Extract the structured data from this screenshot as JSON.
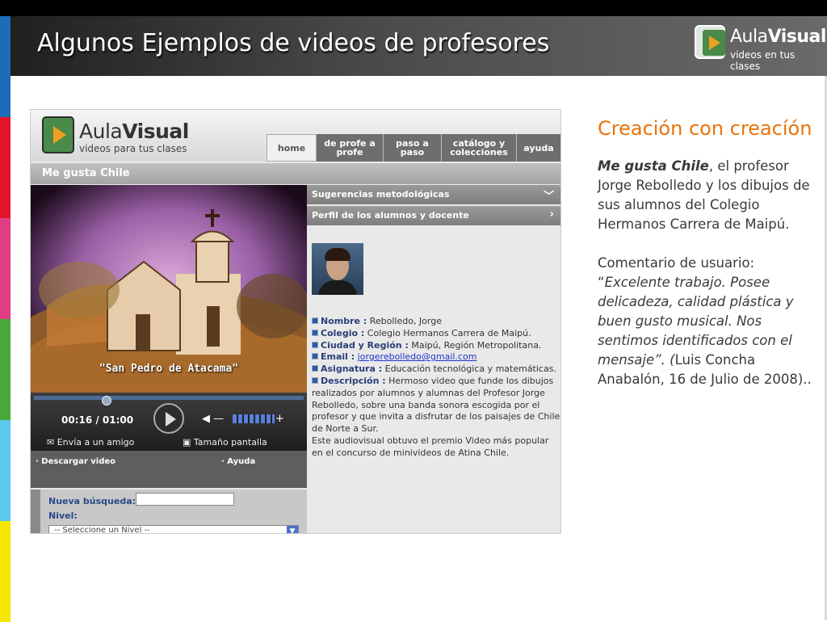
{
  "slide": {
    "title": "Algunos Ejemplos de videos de profesores",
    "logo": {
      "aula": "Aula",
      "visual": "Visual",
      "subtitle": "videos en tus clases"
    },
    "stripe_colors": [
      "#1e6bb8",
      "#e4142a",
      "#e03d86",
      "#4aa83a",
      "#5bc8ec",
      "#f6e600"
    ]
  },
  "screenshot": {
    "logo": {
      "aula": "Aula",
      "visual": "Visual",
      "subtitle": "videos para tus clases"
    },
    "nav": [
      {
        "label": "home"
      },
      {
        "label": "de profe a profe"
      },
      {
        "label": "paso a paso"
      },
      {
        "label": "catálogo y colecciones"
      },
      {
        "label": "ayuda"
      }
    ],
    "page_title": "Me gusta Chile",
    "video": {
      "caption": "\"San Pedro de Atacama\"",
      "time": "00:16 / 01:00",
      "progress": 0.27,
      "share_label": "Envía a un amigo",
      "fullscreen_label": "Tamaño pantalla"
    },
    "links": {
      "download": "· Descargar video",
      "help": "· Ayuda"
    },
    "search": {
      "new_search_label": "Nueva búsqueda:",
      "level_label": "Nivel:",
      "level_select": "-- Seleccione un Nivel --"
    },
    "accordion": [
      {
        "label": "Sugerencias metodológicas",
        "chevron": "﹀"
      },
      {
        "label": "Perfil de los alumnos y docente",
        "chevron": "›"
      }
    ],
    "profile": {
      "nombre_key": "Nombre :",
      "nombre": "Rebolledo, Jorge",
      "colegio_key": "Colegio :",
      "colegio": "Colegio Hermanos Carrera de Maipú.",
      "region_key": "Ciudad y Región :",
      "region": "Maipú, Región Metropolitana.",
      "email_key": "Email :",
      "email": "jorgerebolledo@gmail.com",
      "asignatura_key": "Asignatura :",
      "asignatura": "Educación tecnológica y matemáticas.",
      "descripcion_key": "Descripción :",
      "descripcion": "Hermoso video que funde los dibujos realizados por alumnos y alumnas del Profesor Jorge Rebolledo, sobre una banda sonora escogida por el profesor y que invita a disfrutar de los paisajes de Chile de Norte a Sur.",
      "premio": "Este audiovisual obtuvo el premio Video más popular en el concurso de minivideos de Atina Chile."
    }
  },
  "side_text": {
    "heading": "Creación con creacíón",
    "video_name": "Me gusta Chile",
    "description_rest": ", el profesor Jorge Rebolledo y los dibujos de sus alumnos del Colegio Hermanos Carrera de Maipú.",
    "comment_label": "Comentario de usuario: “",
    "comment": "Excelente trabajo. Posee delicadeza, calidad plástica y buen gusto musical. Nos sentimos identificados con el mensaje”. (",
    "author": "Luis Concha Anabalón, 16 de Julio de 2008).."
  }
}
